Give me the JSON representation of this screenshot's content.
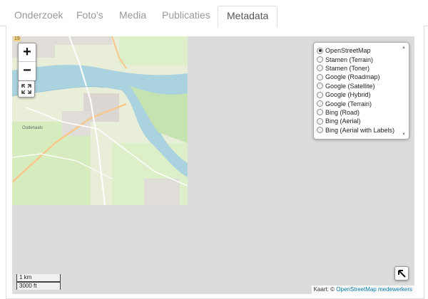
{
  "tabs": [
    {
      "label": "Onderzoek",
      "active": false
    },
    {
      "label": "Foto's",
      "active": false
    },
    {
      "label": "Media",
      "active": false
    },
    {
      "label": "Publicaties",
      "active": false
    },
    {
      "label": "Metadata",
      "active": true
    }
  ],
  "map": {
    "zoom_in_label": "+",
    "zoom_out_label": "−",
    "fullscreen_icon": "fullscreen-icon",
    "expand_icon": "arrow-up-left-icon",
    "tile_labels": {
      "top_left": "19",
      "town": "Oudenaals"
    },
    "layers": {
      "selected": "OpenStreetMap",
      "options": [
        "OpenStreetMap",
        "Stamen (Terrain)",
        "Stamen (Toner)",
        "Google (Roadmap)",
        "Google (Satellite)",
        "Google (Hybrid)",
        "Google (Terrain)",
        "Bing (Road)",
        "Bing (Aerial)",
        "Bing (Aerial with Labels)"
      ]
    },
    "scale": {
      "metric": "1 km",
      "imperial": "3000 ft"
    },
    "attribution": {
      "prefix": "Kaart: ©",
      "link": "OpenStreetMap medewerkers"
    }
  },
  "colors": {
    "map_background": "#dcdcdc",
    "water": "#aad3df",
    "land": "#e9eed9",
    "accent_link": "#0078a8"
  }
}
